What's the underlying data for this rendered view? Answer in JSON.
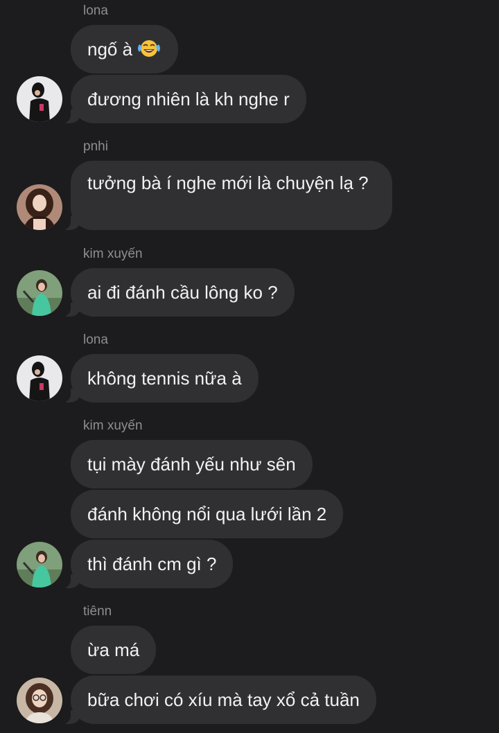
{
  "messages": [
    {
      "sender": "lona",
      "text": "ngố à",
      "emoji": "face-with-tears-of-joy"
    },
    {
      "sender": "",
      "text": "đương nhiên là kh nghe r"
    },
    {
      "sender": "pnhi",
      "text": "tưởng bà í nghe mới là chuyện lạ ?"
    },
    {
      "sender": "kim xuyến",
      "text": "ai đi đánh cầu lông ko ?"
    },
    {
      "sender": "lona",
      "text": "không tennis nữa à"
    },
    {
      "sender": "kim xuyến",
      "text": "tụi mày đánh yếu như sên"
    },
    {
      "sender": "",
      "text": "đánh không nổi qua lưới lần 2"
    },
    {
      "sender": "",
      "text": "thì đánh cm gì ?"
    },
    {
      "sender": "tiênn",
      "text": "ừa má"
    },
    {
      "sender": "",
      "text": "bữa chơi có xíu mà tay xổ cả tuần"
    }
  ],
  "avatars": {
    "lona": "avatar-lona",
    "pnhi": "avatar-pnhi",
    "kim_xuyen": "avatar-kim-xuyen",
    "tienn": "avatar-tienn"
  },
  "colors": {
    "background": "#1c1c1e",
    "bubble": "#303032",
    "text": "#f2f2f4",
    "sender_name": "#8e8e93"
  }
}
